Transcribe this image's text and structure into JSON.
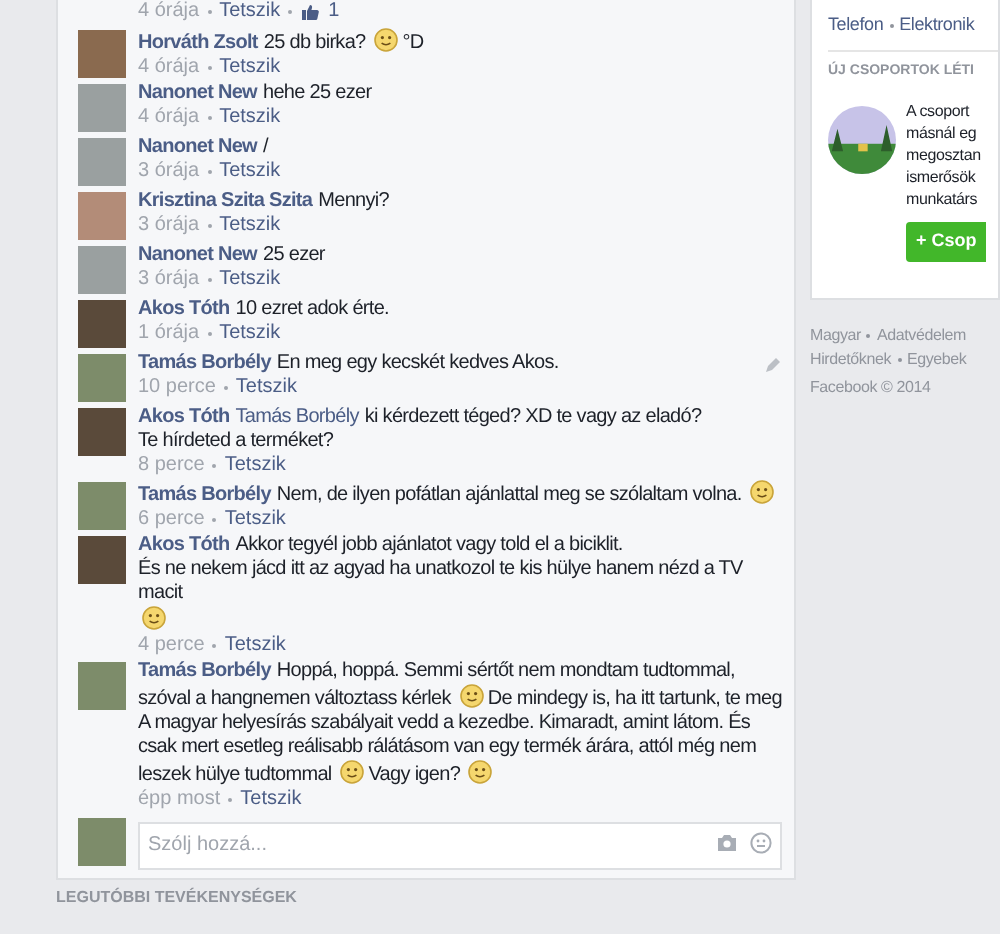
{
  "top_meta": {
    "time": "4 órája",
    "like": "Tetszik",
    "likes": "1"
  },
  "comments": [
    {
      "author": "Horváth Zsolt",
      "parts": [
        {
          "kind": "text",
          "text": "25 db birka?"
        },
        {
          "kind": "smiley"
        },
        {
          "kind": "text",
          "text": "°D"
        }
      ],
      "time": "4 órája",
      "like": "Tetszik",
      "editable": false
    },
    {
      "author": "Nanonet New",
      "parts": [
        {
          "kind": "text",
          "text": "hehe 25 ezer"
        }
      ],
      "time": "4 órája",
      "like": "Tetszik",
      "editable": false
    },
    {
      "author": "Nanonet New",
      "parts": [
        {
          "kind": "text",
          "text": "/"
        }
      ],
      "time": "3 órája",
      "like": "Tetszik",
      "editable": false
    },
    {
      "author": "Krisztina Szita Szita",
      "parts": [
        {
          "kind": "text",
          "text": "Mennyi?"
        }
      ],
      "time": "3 órája",
      "like": "Tetszik",
      "editable": false
    },
    {
      "author": "Nanonet New",
      "parts": [
        {
          "kind": "text",
          "text": "25 ezer"
        }
      ],
      "time": "3 órája",
      "like": "Tetszik",
      "editable": false
    },
    {
      "author": "Akos Tóth",
      "parts": [
        {
          "kind": "text",
          "text": "10 ezret adok érte."
        }
      ],
      "time": "1 órája",
      "like": "Tetszik",
      "editable": false
    },
    {
      "author": "Tamás Borbély",
      "parts": [
        {
          "kind": "text",
          "text": "En meg egy kecskét kedves Akos."
        }
      ],
      "time": "10 perce",
      "like": "Tetszik",
      "editable": true
    },
    {
      "author": "Akos Tóth",
      "parts": [
        {
          "kind": "mention",
          "text": "Tamás Borbély"
        },
        {
          "kind": "text",
          "text": "ki kérdezett téged? XD te vagy az eladó?"
        },
        {
          "kind": "break"
        },
        {
          "kind": "text",
          "text": "Te hírdeted a terméket?"
        }
      ],
      "time": "8 perce",
      "like": "Tetszik",
      "editable": false
    },
    {
      "author": "Tamás Borbély",
      "parts": [
        {
          "kind": "text",
          "text": "Nem, de ilyen pofátlan ajánlattal meg se szólaltam volna."
        },
        {
          "kind": "smiley"
        }
      ],
      "time": "6 perce",
      "like": "Tetszik",
      "editable": false
    },
    {
      "author": "Akos Tóth",
      "parts": [
        {
          "kind": "text",
          "text": "Akkor tegyél jobb ajánlatot vagy told el a biciklit."
        },
        {
          "kind": "break"
        },
        {
          "kind": "text",
          "text": "És ne nekem jácd itt az agyad ha unatkozol te kis hülye hanem nézd a TV macit"
        },
        {
          "kind": "break"
        },
        {
          "kind": "smiley"
        }
      ],
      "time": "4 perce",
      "like": "Tetszik",
      "editable": false
    },
    {
      "author": "Tamás Borbély",
      "parts": [
        {
          "kind": "text",
          "text": "Hoppá, hoppá. Semmi sértőt nem mondtam tudtommal, szóval a hangnemen változtass kérlek"
        },
        {
          "kind": "smiley"
        },
        {
          "kind": "text",
          "text": "De mindegy is, ha itt tartunk, te meg A magyar helyesírás szabályait vedd a kezedbe. Kimaradt, amint látom. És csak mert esetleg reálisabb rálátásom van egy termék árára, attól még nem leszek hülye tudtommal"
        },
        {
          "kind": "smiley"
        },
        {
          "kind": "text",
          "text": "Vagy igen?"
        },
        {
          "kind": "smiley"
        }
      ],
      "time": "épp most",
      "like": "Tetszik",
      "editable": false
    }
  ],
  "comment_box": {
    "placeholder": "Szólj hozzá..."
  },
  "section_heading": "LEGUTÓBBI TEVÉKENYSÉGEK",
  "sidebar": {
    "categories": [
      "Telefon",
      "Elektronik"
    ],
    "heading": "ÚJ CSOPORTOK LÉTI",
    "description_lines": [
      "A csoport",
      "másnál eg",
      "megosztan",
      "ismerősök",
      "munkatárs"
    ],
    "button": "+ Csop",
    "footer_rows": [
      [
        "Magyar",
        "Adatvédelem"
      ],
      [
        "Hirdetőknek",
        "Egyebek"
      ]
    ],
    "copyright": "Facebook © 2014"
  }
}
